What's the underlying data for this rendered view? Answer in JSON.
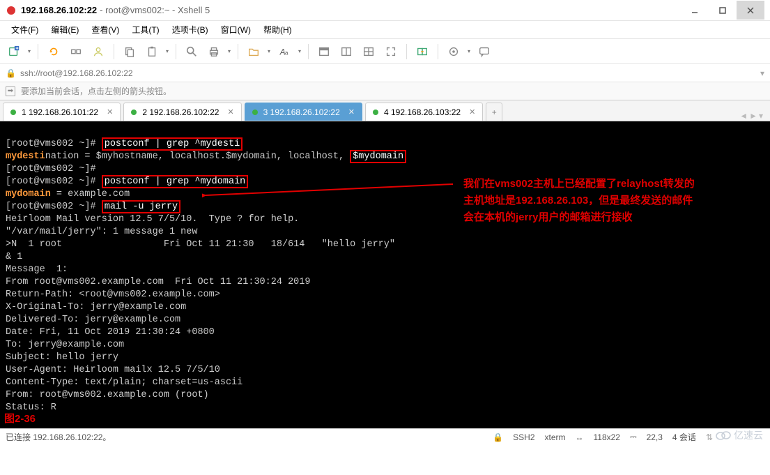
{
  "window": {
    "title": "192.168.26.102:22",
    "subtitle": " - root@vms002:~ - Xshell 5"
  },
  "menu": {
    "file": "文件(F)",
    "edit": "编辑(E)",
    "view": "查看(V)",
    "tools": "工具(T)",
    "tabs": "选项卡(B)",
    "window": "窗口(W)",
    "help": "帮助(H)"
  },
  "address": {
    "url": "ssh://root@192.168.26.102:22"
  },
  "tip": {
    "text": "要添加当前会话，点击左侧的箭头按钮。"
  },
  "tabs": [
    {
      "label": "1 192.168.26.101:22",
      "active": false
    },
    {
      "label": "2 192.168.26.102:22",
      "active": false
    },
    {
      "label": "3 192.168.26.102:22",
      "active": true
    },
    {
      "label": "4 192.168.26.103:22",
      "active": false
    }
  ],
  "term": {
    "line1_prefix": "[root@vms002 ~]# ",
    "hl1": "postconf | grep ^mydesti",
    "line2a": "mydesti",
    "line2b": "nation = $myhostname, localhost.$mydomain, localhost, ",
    "hl2": "$mydomain",
    "line3": "[root@vms002 ~]#",
    "line4_prefix": "[root@vms002 ~]# ",
    "hl3": "postconf | grep ^mydomain",
    "line5a": "mydomain",
    "line5b": " = example.com",
    "line6_prefix": "[root@vms002 ~]# ",
    "hl4": "mail -u jerry",
    "body": "Heirloom Mail version 12.5 7/5/10.  Type ? for help.\n\"/var/mail/jerry\": 1 message 1 new\n>N  1 root                  Fri Oct 11 21:30   18/614   \"hello jerry\"\n& 1\nMessage  1:\nFrom root@vms002.example.com  Fri Oct 11 21:30:24 2019\nReturn-Path: <root@vms002.example.com>\nX-Original-To: jerry@example.com\nDelivered-To: jerry@example.com\nDate: Fri, 11 Oct 2019 21:30:24 +0800\nTo: jerry@example.com\nSubject: hello jerry\nUser-Agent: Heirloom mailx 12.5 7/5/10\nContent-Type: text/plain; charset=us-ascii\nFrom: root@vms002.example.com (root)\nStatus: R",
    "annot1": "我们在vms002主机上已经配置了relayhost转发的",
    "annot2": "主机地址是192.168.26.103，但是最终发送的邮件",
    "annot3": "会在本机的jerry用户的邮箱进行接收",
    "figlabel": "图2-36"
  },
  "status": {
    "conn": "已连接 192.168.26.102:22。",
    "ssh": "SSH2",
    "term": "xterm",
    "size": "118x22",
    "pos": "22,3",
    "sess": "4 会话"
  },
  "watermark": "亿速云"
}
